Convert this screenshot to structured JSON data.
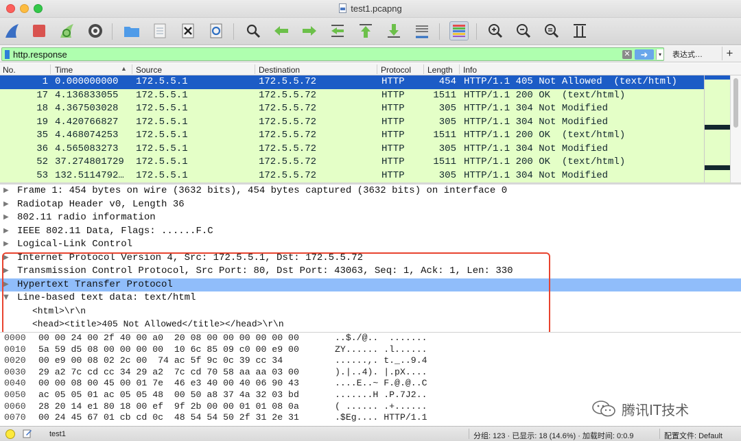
{
  "window": {
    "title": "test1.pcapng"
  },
  "toolbar": {
    "buttons": [
      "shark-fin-start-icon",
      "stop-capture-icon",
      "restart-capture-icon",
      "capture-options-icon",
      "open-file-icon",
      "save-file-icon",
      "close-file-icon",
      "reload-file-icon",
      "find-packet-icon",
      "go-back-icon",
      "go-forward-icon",
      "go-to-packet-icon",
      "go-first-icon",
      "go-last-icon",
      "autoscroll-icon",
      "colorize-icon",
      "zoom-in-icon",
      "zoom-out-icon",
      "zoom-normal-icon",
      "resize-columns-icon"
    ]
  },
  "filter": {
    "value": "http.response",
    "clear_glyph": "✕",
    "apply_glyph": "➜",
    "dropdown_glyph": "▾",
    "expression_label": "表达式…",
    "add_label": "+"
  },
  "packet_list": {
    "columns": [
      "No.",
      "Time",
      "Source",
      "Destination",
      "Protocol",
      "Length",
      "Info"
    ],
    "rows": [
      {
        "no": "1",
        "time": "0.000000000",
        "src": "172.5.5.1",
        "dst": "172.5.5.72",
        "proto": "HTTP",
        "len": "454",
        "info": "HTTP/1.1 405 Not Allowed  (text/html)",
        "selected": true
      },
      {
        "no": "17",
        "time": "4.136833055",
        "src": "172.5.5.1",
        "dst": "172.5.5.72",
        "proto": "HTTP",
        "len": "1511",
        "info": "HTTP/1.1 200 OK  (text/html)"
      },
      {
        "no": "18",
        "time": "4.367503028",
        "src": "172.5.5.1",
        "dst": "172.5.5.72",
        "proto": "HTTP",
        "len": "305",
        "info": "HTTP/1.1 304 Not Modified"
      },
      {
        "no": "19",
        "time": "4.420766827",
        "src": "172.5.5.1",
        "dst": "172.5.5.72",
        "proto": "HTTP",
        "len": "305",
        "info": "HTTP/1.1 304 Not Modified"
      },
      {
        "no": "35",
        "time": "4.468074253",
        "src": "172.5.5.1",
        "dst": "172.5.5.72",
        "proto": "HTTP",
        "len": "1511",
        "info": "HTTP/1.1 200 OK  (text/html)"
      },
      {
        "no": "36",
        "time": "4.565083273",
        "src": "172.5.5.1",
        "dst": "172.5.5.72",
        "proto": "HTTP",
        "len": "305",
        "info": "HTTP/1.1 304 Not Modified"
      },
      {
        "no": "52",
        "time": "37.274801729",
        "src": "172.5.5.1",
        "dst": "172.5.5.72",
        "proto": "HTTP",
        "len": "1511",
        "info": "HTTP/1.1 200 OK  (text/html)"
      },
      {
        "no": "53",
        "time": "132.5114792…",
        "src": "172.5.5.1",
        "dst": "172.5.5.72",
        "proto": "HTTP",
        "len": "305",
        "info": "HTTP/1.1 304 Not Modified"
      }
    ]
  },
  "details": {
    "collapsed_arrow": "▶",
    "expanded_arrow": "▼",
    "items": [
      {
        "label": "Frame 1: 454 bytes on wire (3632 bits), 454 bytes captured (3632 bits) on interface 0",
        "expanded": false
      },
      {
        "label": "Radiotap Header v0, Length 36",
        "expanded": false
      },
      {
        "label": "802.11 radio information",
        "expanded": false
      },
      {
        "label": "IEEE 802.11 Data, Flags: ......F.C",
        "expanded": false
      },
      {
        "label": "Logical-Link Control",
        "expanded": false
      },
      {
        "label": "Internet Protocol Version 4, Src: 172.5.5.1, Dst: 172.5.5.72",
        "expanded": false
      },
      {
        "label": "Transmission Control Protocol, Src Port: 80, Dst Port: 43063, Seq: 1, Ack: 1, Len: 330",
        "expanded": false
      },
      {
        "label": "Hypertext Transfer Protocol",
        "expanded": false,
        "highlighted": true
      },
      {
        "label": "Line-based text data: text/html",
        "expanded": true
      }
    ],
    "children": [
      "<html>\\r\\n",
      "<head><title>405 Not Allowed</title></head>\\r\\n"
    ]
  },
  "bytes": [
    {
      "offset": "0000",
      "hex": "00 00 24 00 2f 40 00 a0  20 08 00 00 00 00 00 00",
      "ascii": "..$./@..  ......."
    },
    {
      "offset": "0010",
      "hex": "5a 59 d5 08 00 00 00 00  10 6c 85 09 c0 00 e9 00",
      "ascii": "ZY...... .l......"
    },
    {
      "offset": "0020",
      "hex": "00 e9 00 08 02 2c 00  74 ac 5f 9c 0c 39 cc 34",
      "ascii": "......,. t._..9.4"
    },
    {
      "offset": "0030",
      "hex": "29 a2 7c cd cc 34 29 a2  7c cd 70 58 aa aa 03 00",
      "ascii": ").|..4). |.pX...."
    },
    {
      "offset": "0040",
      "hex": "00 00 08 00 45 00 01 7e  46 e3 40 00 40 06 90 43",
      "ascii": "....E..~ F.@.@..C"
    },
    {
      "offset": "0050",
      "hex": "ac 05 05 01 ac 05 05 48  00 50 a8 37 4a 32 03 bd",
      "ascii": ".......H .P.7J2.."
    },
    {
      "offset": "0060",
      "hex": "28 20 14 e1 80 18 00 ef  9f 2b 00 00 01 01 08 0a",
      "ascii": "( ...... .+......"
    },
    {
      "offset": "0070",
      "hex": "00 24 45 67 01 cb cd 0c  48 54 54 50 2f 31 2e 31",
      "ascii": ".$Eg.... HTTP/1.1"
    }
  ],
  "watermark": {
    "text": "腾讯IT技术"
  },
  "status": {
    "file": "test1",
    "stats": "分组: 123 · 已显示: 18 (14.6%) · 加载时间: 0:0.9",
    "profile": "配置文件: Default"
  },
  "colors": {
    "row_bg": "#e4ffc7",
    "row_text": "#12272e",
    "selected_bg": "#1c5cc6",
    "filter_bg": "#afffaf",
    "highlight_bg": "#90bdfa",
    "annotation": "#e8432e"
  }
}
